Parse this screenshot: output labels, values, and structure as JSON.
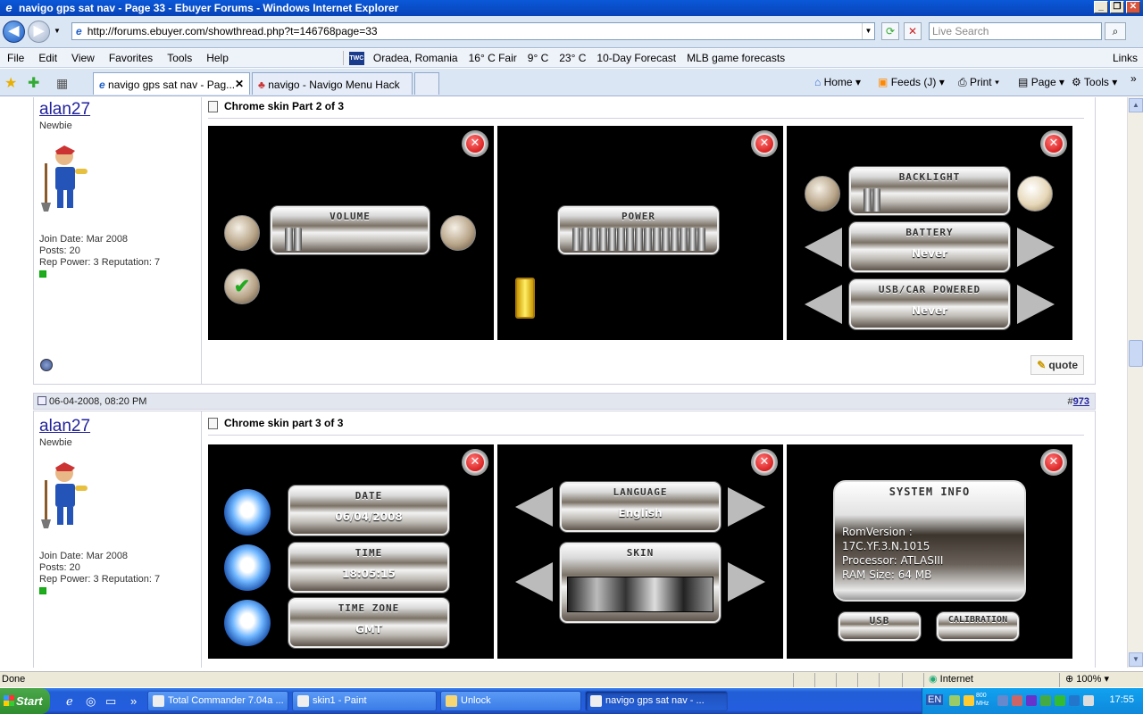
{
  "window": {
    "title": "navigo gps sat nav - Page 33 - Ebuyer Forums - Windows Internet Explorer",
    "minimize": "_",
    "restore": "❐",
    "close": "✕"
  },
  "address": {
    "url": "http://forums.ebuyer.com/showthread.php?t=146768page=33",
    "search_placeholder": "Live Search"
  },
  "menu": {
    "items": [
      "File",
      "Edit",
      "View",
      "Favorites",
      "Tools",
      "Help"
    ],
    "weather": {
      "badge": "TWC",
      "location": "Oradea, Romania",
      "w1": "16° C Fair",
      "w2": "9° C",
      "w3": "23° C",
      "forecast": "10-Day Forecast",
      "mlb": "MLB game forecasts"
    },
    "links": "Links"
  },
  "tabs": [
    {
      "label": "navigo gps sat nav - Pag...",
      "active": true
    },
    {
      "label": "navigo - Navigo Menu Hack",
      "active": false
    }
  ],
  "toolbar": {
    "home": "Home",
    "feeds": "Feeds (J)",
    "print": "Print",
    "page": "Page",
    "tools": "Tools"
  },
  "posts": [
    {
      "username": "alan27",
      "usertitle": "Newbie",
      "join": "Join Date: Mar 2008",
      "posts": "Posts: 20",
      "rep": "Rep Power: 3 Reputation: 7",
      "title": "Chrome skin Part 2 of 3",
      "quote": "quote"
    },
    {
      "date": "06-04-2008, 08:20 PM",
      "hash": "#",
      "number": "973",
      "username": "alan27",
      "usertitle": "Newbie",
      "join": "Join Date: Mar 2008",
      "posts": "Posts: 20",
      "rep": "Rep Power: 3 Reputation: 7",
      "title": "Chrome skin part 3 of 3"
    }
  ],
  "screens": {
    "volume": {
      "label": "VOLUME"
    },
    "power": {
      "label": "POWER"
    },
    "backlight": {
      "label": "BACKLIGHT"
    },
    "battery": {
      "label": "BATTERY",
      "value": "Never"
    },
    "usbcar": {
      "label": "USB/CAR POWERED",
      "value": "Never"
    },
    "date": {
      "label": "DATE",
      "value": "06/04/2008"
    },
    "time": {
      "label": "TIME",
      "value": "18:05:15"
    },
    "timezone": {
      "label": "TIME ZONE",
      "value": "GMT"
    },
    "language": {
      "label": "LANGUAGE",
      "value": "English"
    },
    "skin": {
      "label": "SKIN"
    },
    "sysinfo": {
      "label": "SYSTEM INFO",
      "rom_label": "RomVersion :",
      "rom": "17C.YF.3.N.1015",
      "processor": "Processor: ATLASIII",
      "ram": "RAM Size: 64 MB"
    },
    "usb_btn": "USB",
    "calib_btn": "CALIBRATION"
  },
  "status": {
    "text": "Done",
    "zone": "Internet",
    "zoom": "100%"
  },
  "taskbar": {
    "start": "Start",
    "tasks": [
      {
        "label": "Total Commander 7.04a ...",
        "active": false
      },
      {
        "label": "skin1 - Paint",
        "active": false
      },
      {
        "label": "Unlock",
        "active": false
      },
      {
        "label": "navigo gps sat nav - ...",
        "active": true
      }
    ],
    "lang": "EN",
    "cpu": "800 MHz",
    "clock": "17:55"
  }
}
